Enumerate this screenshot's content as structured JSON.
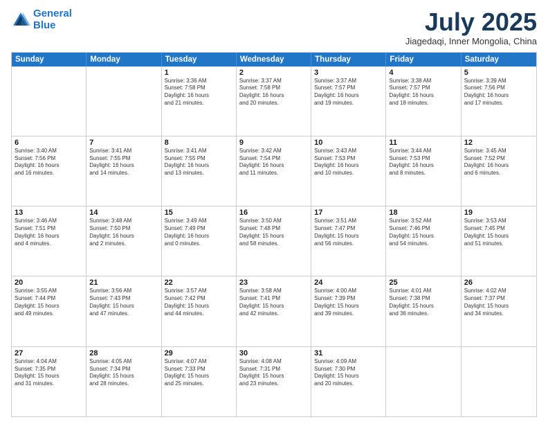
{
  "logo": {
    "line1": "General",
    "line2": "Blue"
  },
  "title": "July 2025",
  "subtitle": "Jiagedaqi, Inner Mongolia, China",
  "days": [
    "Sunday",
    "Monday",
    "Tuesday",
    "Wednesday",
    "Thursday",
    "Friday",
    "Saturday"
  ],
  "weeks": [
    [
      {
        "day": "",
        "info": ""
      },
      {
        "day": "",
        "info": ""
      },
      {
        "day": "1",
        "info": "Sunrise: 3:36 AM\nSunset: 7:58 PM\nDaylight: 16 hours\nand 21 minutes."
      },
      {
        "day": "2",
        "info": "Sunrise: 3:37 AM\nSunset: 7:58 PM\nDaylight: 16 hours\nand 20 minutes."
      },
      {
        "day": "3",
        "info": "Sunrise: 3:37 AM\nSunset: 7:57 PM\nDaylight: 16 hours\nand 19 minutes."
      },
      {
        "day": "4",
        "info": "Sunrise: 3:38 AM\nSunset: 7:57 PM\nDaylight: 16 hours\nand 18 minutes."
      },
      {
        "day": "5",
        "info": "Sunrise: 3:39 AM\nSunset: 7:56 PM\nDaylight: 16 hours\nand 17 minutes."
      }
    ],
    [
      {
        "day": "6",
        "info": "Sunrise: 3:40 AM\nSunset: 7:56 PM\nDaylight: 16 hours\nand 16 minutes."
      },
      {
        "day": "7",
        "info": "Sunrise: 3:41 AM\nSunset: 7:55 PM\nDaylight: 16 hours\nand 14 minutes."
      },
      {
        "day": "8",
        "info": "Sunrise: 3:41 AM\nSunset: 7:55 PM\nDaylight: 16 hours\nand 13 minutes."
      },
      {
        "day": "9",
        "info": "Sunrise: 3:42 AM\nSunset: 7:54 PM\nDaylight: 16 hours\nand 11 minutes."
      },
      {
        "day": "10",
        "info": "Sunrise: 3:43 AM\nSunset: 7:53 PM\nDaylight: 16 hours\nand 10 minutes."
      },
      {
        "day": "11",
        "info": "Sunrise: 3:44 AM\nSunset: 7:53 PM\nDaylight: 16 hours\nand 8 minutes."
      },
      {
        "day": "12",
        "info": "Sunrise: 3:45 AM\nSunset: 7:52 PM\nDaylight: 16 hours\nand 6 minutes."
      }
    ],
    [
      {
        "day": "13",
        "info": "Sunrise: 3:46 AM\nSunset: 7:51 PM\nDaylight: 16 hours\nand 4 minutes."
      },
      {
        "day": "14",
        "info": "Sunrise: 3:48 AM\nSunset: 7:50 PM\nDaylight: 16 hours\nand 2 minutes."
      },
      {
        "day": "15",
        "info": "Sunrise: 3:49 AM\nSunset: 7:49 PM\nDaylight: 16 hours\nand 0 minutes."
      },
      {
        "day": "16",
        "info": "Sunrise: 3:50 AM\nSunset: 7:48 PM\nDaylight: 15 hours\nand 58 minutes."
      },
      {
        "day": "17",
        "info": "Sunrise: 3:51 AM\nSunset: 7:47 PM\nDaylight: 15 hours\nand 56 minutes."
      },
      {
        "day": "18",
        "info": "Sunrise: 3:52 AM\nSunset: 7:46 PM\nDaylight: 15 hours\nand 54 minutes."
      },
      {
        "day": "19",
        "info": "Sunrise: 3:53 AM\nSunset: 7:45 PM\nDaylight: 15 hours\nand 51 minutes."
      }
    ],
    [
      {
        "day": "20",
        "info": "Sunrise: 3:55 AM\nSunset: 7:44 PM\nDaylight: 15 hours\nand 49 minutes."
      },
      {
        "day": "21",
        "info": "Sunrise: 3:56 AM\nSunset: 7:43 PM\nDaylight: 15 hours\nand 47 minutes."
      },
      {
        "day": "22",
        "info": "Sunrise: 3:57 AM\nSunset: 7:42 PM\nDaylight: 15 hours\nand 44 minutes."
      },
      {
        "day": "23",
        "info": "Sunrise: 3:58 AM\nSunset: 7:41 PM\nDaylight: 15 hours\nand 42 minutes."
      },
      {
        "day": "24",
        "info": "Sunrise: 4:00 AM\nSunset: 7:39 PM\nDaylight: 15 hours\nand 39 minutes."
      },
      {
        "day": "25",
        "info": "Sunrise: 4:01 AM\nSunset: 7:38 PM\nDaylight: 15 hours\nand 36 minutes."
      },
      {
        "day": "26",
        "info": "Sunrise: 4:02 AM\nSunset: 7:37 PM\nDaylight: 15 hours\nand 34 minutes."
      }
    ],
    [
      {
        "day": "27",
        "info": "Sunrise: 4:04 AM\nSunset: 7:35 PM\nDaylight: 15 hours\nand 31 minutes."
      },
      {
        "day": "28",
        "info": "Sunrise: 4:05 AM\nSunset: 7:34 PM\nDaylight: 15 hours\nand 28 minutes."
      },
      {
        "day": "29",
        "info": "Sunrise: 4:07 AM\nSunset: 7:33 PM\nDaylight: 15 hours\nand 25 minutes."
      },
      {
        "day": "30",
        "info": "Sunrise: 4:08 AM\nSunset: 7:31 PM\nDaylight: 15 hours\nand 23 minutes."
      },
      {
        "day": "31",
        "info": "Sunrise: 4:09 AM\nSunset: 7:30 PM\nDaylight: 15 hours\nand 20 minutes."
      },
      {
        "day": "",
        "info": ""
      },
      {
        "day": "",
        "info": ""
      }
    ]
  ]
}
